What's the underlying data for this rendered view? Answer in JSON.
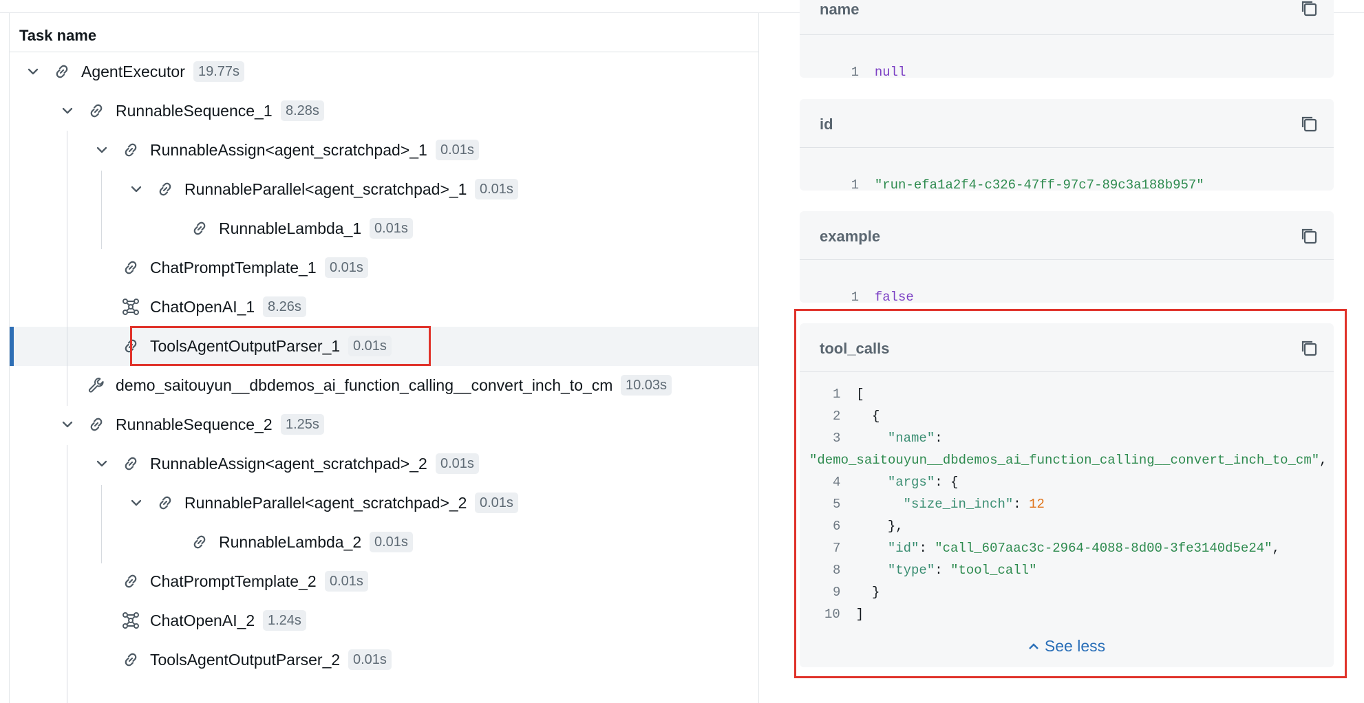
{
  "tree": {
    "header": "Task name",
    "rows": [
      {
        "label": "AgentExecutor",
        "duration": "19.77s",
        "icon": "chain-link-icon",
        "expanded": true
      },
      {
        "label": "RunnableSequence_1",
        "duration": "8.28s",
        "icon": "chain-link-icon",
        "expanded": true
      },
      {
        "label": "RunnableAssign<agent_scratchpad>_1",
        "duration": "0.01s",
        "icon": "chain-link-icon",
        "expanded": true
      },
      {
        "label": "RunnableParallel<agent_scratchpad>_1",
        "duration": "0.01s",
        "icon": "chain-link-icon",
        "expanded": true
      },
      {
        "label": "RunnableLambda_1",
        "duration": "0.01s",
        "icon": "chain-link-icon"
      },
      {
        "label": "ChatPromptTemplate_1",
        "duration": "0.01s",
        "icon": "chain-link-icon"
      },
      {
        "label": "ChatOpenAI_1",
        "duration": "8.26s",
        "icon": "llm-node-icon"
      },
      {
        "label": "ToolsAgentOutputParser_1",
        "duration": "0.01s",
        "icon": "chain-link-icon",
        "selected": true
      },
      {
        "label": "demo_saitouyun__dbdemos_ai_function_calling__convert_inch_to_cm",
        "duration": "10.03s",
        "icon": "wrench-tool-icon"
      },
      {
        "label": "RunnableSequence_2",
        "duration": "1.25s",
        "icon": "chain-link-icon",
        "expanded": true
      },
      {
        "label": "RunnableAssign<agent_scratchpad>_2",
        "duration": "0.01s",
        "icon": "chain-link-icon",
        "expanded": true
      },
      {
        "label": "RunnableParallel<agent_scratchpad>_2",
        "duration": "0.01s",
        "icon": "chain-link-icon",
        "expanded": true
      },
      {
        "label": "RunnableLambda_2",
        "duration": "0.01s",
        "icon": "chain-link-icon"
      },
      {
        "label": "ChatPromptTemplate_2",
        "duration": "0.01s",
        "icon": "chain-link-icon"
      },
      {
        "label": "ChatOpenAI_2",
        "duration": "1.24s",
        "icon": "llm-node-icon"
      },
      {
        "label": "ToolsAgentOutputParser_2",
        "duration": "0.01s",
        "icon": "chain-link-icon"
      }
    ]
  },
  "detail": {
    "name_card": {
      "title": "name",
      "line_no": "1",
      "value": "null"
    },
    "id_card": {
      "title": "id",
      "line_no": "1",
      "value": "\"run-efa1a2f4-c326-47ff-97c7-89c3a188b957\""
    },
    "example_card": {
      "title": "example",
      "line_no": "1",
      "value": "false"
    },
    "tool_calls_card": {
      "title": "tool_calls",
      "line_numbers": [
        "1",
        "2",
        "3",
        "4",
        "5",
        "6",
        "7",
        "8",
        "9",
        "10"
      ],
      "tokens": {
        "open_bracket": "[",
        "open_brace": "{",
        "name_key": "\"name\"",
        "colon": ": ",
        "name_value": "\"demo_saitouyun__dbdemos_ai_function_calling__convert_inch_to_cm\"",
        "comma": ",",
        "args_key": "\"args\"",
        "args_open": "{",
        "size_key": "\"size_in_inch\"",
        "size_value": "12",
        "args_close": "},",
        "id_key": "\"id\"",
        "id_value": "\"call_607aac3c-2964-4088-8d00-3fe3140d5e24\"",
        "type_key": "\"type\"",
        "type_value": "\"tool_call\"",
        "close_brace": "}",
        "close_bracket": "]"
      },
      "see_less_label": "See less"
    }
  },
  "colors": {
    "highlight_box": "#e0332b",
    "selected_row_accent": "#2f6fb5",
    "link": "#2a6fb8",
    "json_string": "#2e8b4f",
    "json_number": "#e0741b",
    "json_keyword": "#7b3fc4"
  }
}
